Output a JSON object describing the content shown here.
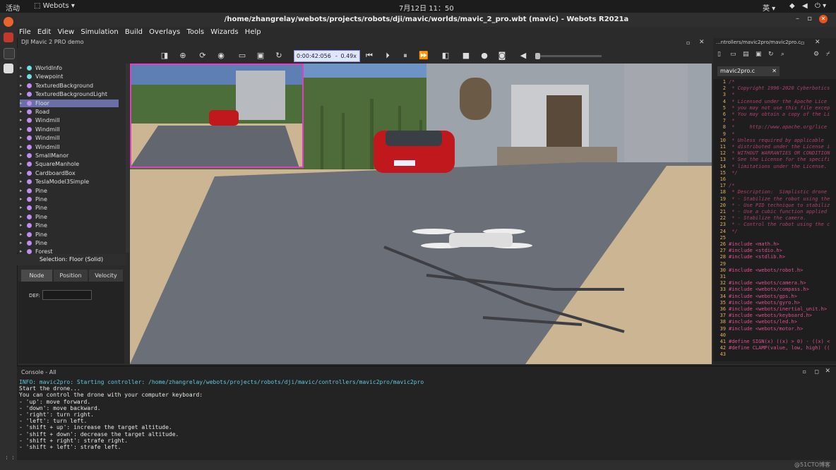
{
  "system_bar": {
    "activities": "活动",
    "app_name": "Webots",
    "clock": "7月12日  11：50",
    "input_method": "英"
  },
  "window": {
    "title": "/home/zhangrelay/webots/projects/robots/dji/mavic/worlds/mavic_2_pro.wbt (mavic) - Webots R2021a"
  },
  "menu": [
    "File",
    "Edit",
    "View",
    "Simulation",
    "Build",
    "Overlays",
    "Tools",
    "Wizards",
    "Help"
  ],
  "subtitle": "DJI Mavic 2 PRO demo",
  "toolbar": {
    "time": "0:00:42:056",
    "speed": "0.49x"
  },
  "scene_tree": [
    {
      "label": "WorldInfo",
      "color": "#6fe0e8"
    },
    {
      "label": "Viewpoint",
      "color": "#6fe0e8"
    },
    {
      "label": "TexturedBackground",
      "color": "#c08ef0"
    },
    {
      "label": "TexturedBackgroundLight",
      "color": "#c08ef0"
    },
    {
      "label": "Floor",
      "color": "#c08ef0",
      "selected": true
    },
    {
      "label": "Road",
      "color": "#c08ef0"
    },
    {
      "label": "Windmill",
      "color": "#c08ef0"
    },
    {
      "label": "Windmill",
      "color": "#c08ef0"
    },
    {
      "label": "Windmill",
      "color": "#c08ef0"
    },
    {
      "label": "Windmill",
      "color": "#c08ef0"
    },
    {
      "label": "SmallManor",
      "color": "#c08ef0"
    },
    {
      "label": "SquareManhole",
      "color": "#c08ef0"
    },
    {
      "label": "CardboardBox",
      "color": "#c08ef0"
    },
    {
      "label": "TeslaModel3Simple",
      "color": "#c08ef0"
    },
    {
      "label": "Pine",
      "color": "#c08ef0"
    },
    {
      "label": "Pine",
      "color": "#c08ef0"
    },
    {
      "label": "Pine",
      "color": "#c08ef0"
    },
    {
      "label": "Pine",
      "color": "#c08ef0"
    },
    {
      "label": "Pine",
      "color": "#c08ef0"
    },
    {
      "label": "Pine",
      "color": "#c08ef0"
    },
    {
      "label": "Pine",
      "color": "#c08ef0"
    },
    {
      "label": "Forest",
      "color": "#c08ef0"
    }
  ],
  "selection": "Selection: Floor (Solid)",
  "field_tabs": [
    "Node",
    "Position",
    "Velocity"
  ],
  "field_panel": {
    "def_label": "DEF:",
    "def_value": ""
  },
  "editor": {
    "title": "...ntrollers/mavic2pro/mavic2pro.c",
    "tab": "mavic2pro.c",
    "lines": [
      {
        "n": "1",
        "t": "/*",
        "k": "cm"
      },
      {
        "n": "2",
        "t": " * Copyright 1996-2020 Cyberbotics",
        "k": "cm"
      },
      {
        "n": "3",
        "t": " *",
        "k": "cm"
      },
      {
        "n": "4",
        "t": " * Licensed under the Apache Lice",
        "k": "cm"
      },
      {
        "n": "5",
        "t": " * you may not use this file excep",
        "k": "cm"
      },
      {
        "n": "6",
        "t": " * You may obtain a copy of the Li",
        "k": "cm"
      },
      {
        "n": "7",
        "t": " *",
        "k": "cm"
      },
      {
        "n": "8",
        "t": " *     http://www.apache.org/lice",
        "k": "cm"
      },
      {
        "n": "9",
        "t": " *",
        "k": "cm"
      },
      {
        "n": "10",
        "t": " * Unless required by applicable",
        "k": "cm"
      },
      {
        "n": "11",
        "t": " * distributed under the License i",
        "k": "cm"
      },
      {
        "n": "12",
        "t": " * WITHOUT WARRANTIES OR CONDITION",
        "k": "cm"
      },
      {
        "n": "13",
        "t": " * See the License for the specifi",
        "k": "cm"
      },
      {
        "n": "14",
        "t": " * limitations under the License.",
        "k": "cm"
      },
      {
        "n": "15",
        "t": " */",
        "k": "cm"
      },
      {
        "n": "16",
        "t": "",
        "k": "cm"
      },
      {
        "n": "17",
        "t": "/*",
        "k": "cm"
      },
      {
        "n": "18",
        "t": " * Description:  Simplistic drone",
        "k": "cm"
      },
      {
        "n": "19",
        "t": " * - Stabilize the robot using the",
        "k": "cm"
      },
      {
        "n": "20",
        "t": " * - Use PID technique to stabiliz",
        "k": "cm"
      },
      {
        "n": "21",
        "t": " * - Use a cubic function applied",
        "k": "cm"
      },
      {
        "n": "22",
        "t": " * - Stabilize the camera.",
        "k": "cm"
      },
      {
        "n": "23",
        "t": " * - Control the robot using the c",
        "k": "cm"
      },
      {
        "n": "24",
        "t": " */",
        "k": "cm"
      },
      {
        "n": "25",
        "t": "",
        "k": "cm"
      },
      {
        "n": "26",
        "t": "#include <math.h>",
        "k": "pp"
      },
      {
        "n": "27",
        "t": "#include <stdio.h>",
        "k": "pp"
      },
      {
        "n": "28",
        "t": "#include <stdlib.h>",
        "k": "pp"
      },
      {
        "n": "29",
        "t": "",
        "k": "pp"
      },
      {
        "n": "30",
        "t": "#include <webots/robot.h>",
        "k": "pp"
      },
      {
        "n": "31",
        "t": "",
        "k": "pp"
      },
      {
        "n": "32",
        "t": "#include <webots/camera.h>",
        "k": "pp"
      },
      {
        "n": "33",
        "t": "#include <webots/compass.h>",
        "k": "pp"
      },
      {
        "n": "34",
        "t": "#include <webots/gps.h>",
        "k": "pp"
      },
      {
        "n": "35",
        "t": "#include <webots/gyro.h>",
        "k": "pp"
      },
      {
        "n": "36",
        "t": "#include <webots/inertial_unit.h>",
        "k": "pp"
      },
      {
        "n": "37",
        "t": "#include <webots/keyboard.h>",
        "k": "pp"
      },
      {
        "n": "38",
        "t": "#include <webots/led.h>",
        "k": "pp"
      },
      {
        "n": "39",
        "t": "#include <webots/motor.h>",
        "k": "pp"
      },
      {
        "n": "40",
        "t": "",
        "k": "pp"
      },
      {
        "n": "41",
        "t": "#define SIGN(x) ((x) > 0) - ((x) <",
        "k": "pp"
      },
      {
        "n": "42",
        "t": "#define CLAMP(value, low, high) ((",
        "k": "pp"
      },
      {
        "n": "43",
        "t": "",
        "k": "pp"
      }
    ]
  },
  "console": {
    "title": "Console - All",
    "lines": [
      {
        "t": "INFO: mavic2pro: Starting controller: /home/zhangrelay/webots/projects/robots/dji/mavic/controllers/mavic2pro/mavic2pro",
        "info": true
      },
      {
        "t": "Start the drone..."
      },
      {
        "t": "You can control the drone with your computer keyboard:"
      },
      {
        "t": "- 'up': move forward."
      },
      {
        "t": "- 'down': move backward."
      },
      {
        "t": "- 'right': turn right."
      },
      {
        "t": "- 'left': turn left."
      },
      {
        "t": "- 'shift + up': increase the target altitude."
      },
      {
        "t": "- 'shift + down': decrease the target altitude."
      },
      {
        "t": "- 'shift + right': strafe right."
      },
      {
        "t": "- 'shift + left': strafe left."
      }
    ]
  },
  "watermark": "@51CTO博客",
  "colors": {
    "selection": "#6b6fa8",
    "info_text": "#5fc8e0",
    "camera_overlay_border": "#e040c0",
    "time_box": "#dfe6ff"
  }
}
